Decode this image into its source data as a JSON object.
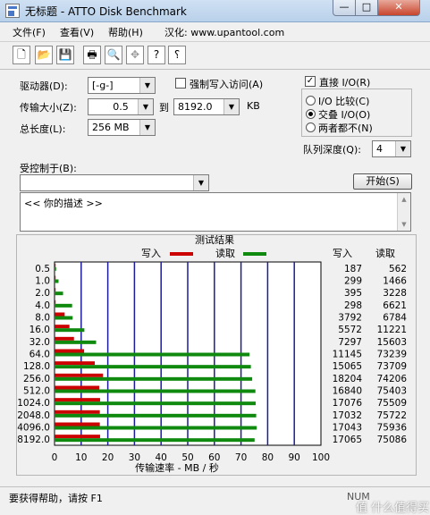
{
  "window": {
    "title": "无标题 - ATTO Disk Benchmark",
    "min_glyph": "—",
    "max_glyph": "□",
    "close_glyph": "✕"
  },
  "menu": {
    "file": "文件(F)",
    "view": "查看(V)",
    "help": "帮助(H)",
    "localized": "汉化: www.upantool.com"
  },
  "toolbar": {
    "buttons": [
      "new-icon",
      "open-icon",
      "save-icon",
      "print-icon",
      "print-preview-icon",
      "move-icon",
      "help-icon",
      "context-help-icon"
    ]
  },
  "settings": {
    "drive_label": "驱动器(D):",
    "drive_value": "[-g-]",
    "transfer_size_label": "传输大小(Z):",
    "transfer_from": "0.5",
    "to_label": "到",
    "transfer_to": "8192.0",
    "unit": "KB",
    "total_length_label": "总长度(L):",
    "total_length_value": "256 MB",
    "force_write_label": "强制写入访问(A)",
    "direct_io_label": "直接 I/O(R)",
    "io_compare_label": "I/O 比较(C)",
    "overlapped_io_label": "交叠 I/O(O)",
    "neither_label": "两者都不(N)",
    "queue_depth_label": "队列深度(Q):",
    "queue_depth_value": "4",
    "controlled_by_label": "受控制于(B):",
    "controlled_by_value": "",
    "start_button": "开始(S)",
    "description": "<<   你的描述   >>"
  },
  "chart_data": {
    "type": "bar",
    "title": "测试结果",
    "legend": {
      "write": "写入",
      "read": "读取",
      "placement": "top"
    },
    "xlabel": "传输速率 - MB / 秒",
    "xlim": [
      0,
      100
    ],
    "xticks": [
      "0",
      "10",
      "20",
      "30",
      "40",
      "50",
      "60",
      "70",
      "80",
      "90",
      "100"
    ],
    "categories": [
      "0.5",
      "1.0",
      "2.0",
      "4.0",
      "8.0",
      "16.0",
      "32.0",
      "64.0",
      "128.0",
      "256.0",
      "512.0",
      "1024.0",
      "2048.0",
      "4096.0",
      "8192.0"
    ],
    "series": [
      {
        "name": "写入",
        "color": "#cc0000",
        "values": [
          0.2,
          0.3,
          0.4,
          0.3,
          3.8,
          5.6,
          7.3,
          11.1,
          15.1,
          18.2,
          16.8,
          17.1,
          17.0,
          17.0,
          17.1
        ],
        "table": [
          "187",
          "299",
          "395",
          "298",
          "3792",
          "5572",
          "7297",
          "11145",
          "15065",
          "18204",
          "16840",
          "17076",
          "17032",
          "17043",
          "17065"
        ]
      },
      {
        "name": "读取",
        "color": "#0f8a0f",
        "values": [
          0.6,
          1.5,
          3.2,
          6.6,
          6.8,
          11.2,
          15.6,
          73.2,
          73.7,
          74.2,
          75.4,
          75.5,
          75.7,
          75.9,
          75.1
        ],
        "table": [
          "562",
          "1466",
          "3228",
          "6621",
          "6784",
          "11221",
          "15603",
          "73239",
          "73709",
          "74206",
          "75403",
          "75509",
          "75722",
          "75936",
          "75086"
        ]
      }
    ],
    "grid": true
  },
  "status": {
    "text": "要获得帮助，请按 F1",
    "num": "NUM",
    "watermark": "值 什么值得买"
  }
}
